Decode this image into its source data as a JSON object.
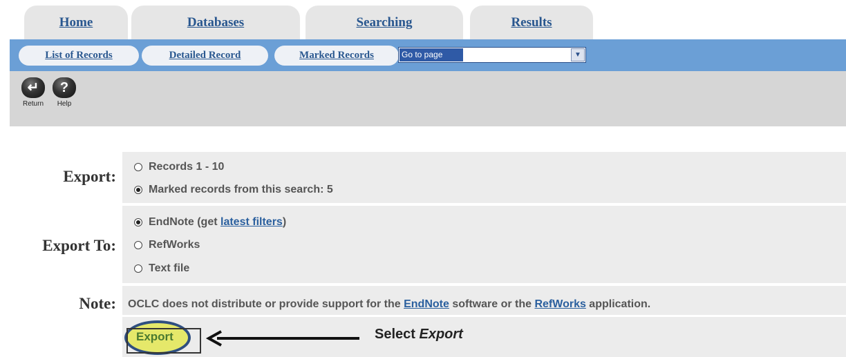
{
  "tabs": [
    "Home",
    "Databases",
    "Searching",
    "Results"
  ],
  "subnav": {
    "list_of_records": "List of Records",
    "detailed_record": "Detailed Record",
    "marked_records": "Marked Records",
    "goto_value": "Go to page"
  },
  "toolbar": {
    "return_label": "Return",
    "help_label": "Help"
  },
  "form": {
    "export_label": "Export:",
    "export_options": [
      {
        "text": "Records 1 - 10",
        "checked": false
      },
      {
        "text": "Marked records from this search: 5",
        "checked": true
      }
    ],
    "export_to_label": "Export To:",
    "endnote_prefix": "EndNote (get ",
    "endnote_link": "latest filters",
    "endnote_suffix": ")",
    "refworks": "RefWorks",
    "text_file": "Text file",
    "note_label": "Note:",
    "note_part1": "OCLC does not distribute or provide support for the ",
    "note_endnote": "EndNote",
    "note_part2": " software or the ",
    "note_refworks": "RefWorks",
    "note_part3": " application.",
    "export_button": "Export"
  },
  "annotation": {
    "select": "Select ",
    "export": "Export"
  },
  "colors": {
    "subnav_bg": "#6b9fd6",
    "tab_bg": "#e6e6e6",
    "link": "#2a5f9e",
    "highlight": "#e5e86a"
  }
}
